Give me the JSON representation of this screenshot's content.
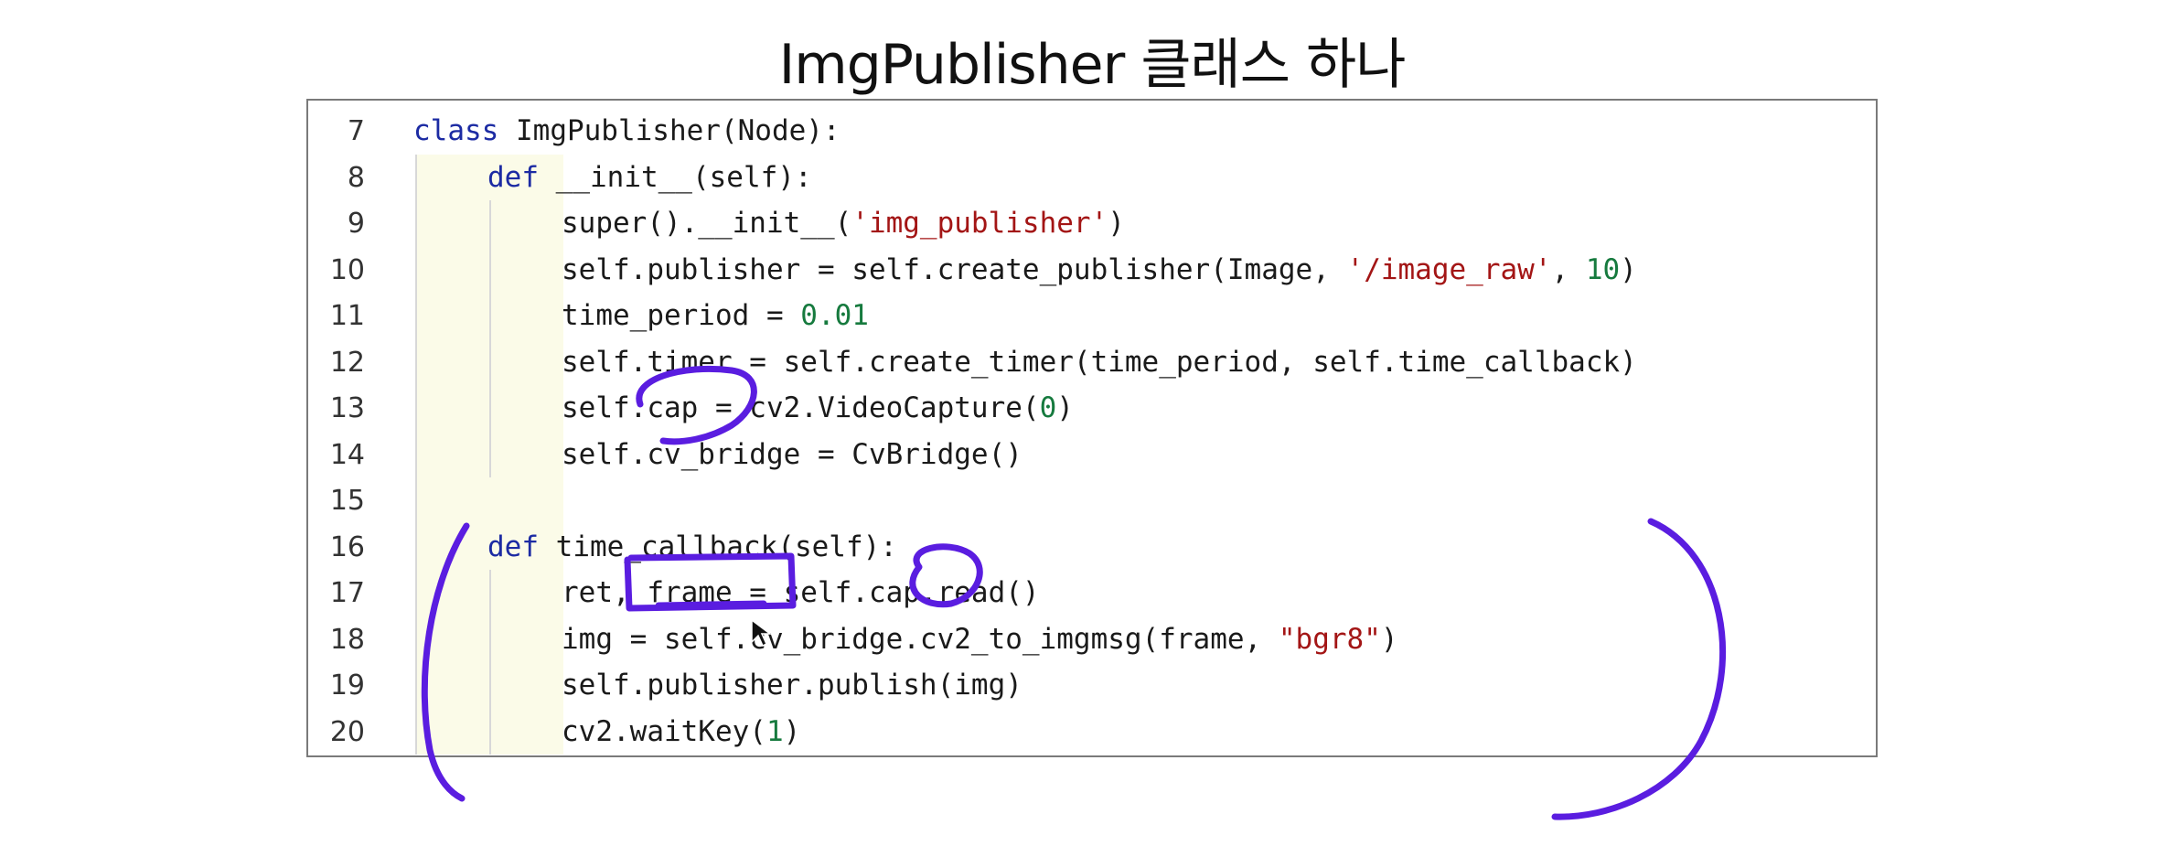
{
  "title": "ImgPublisher 클래스 하나",
  "code": {
    "lines": [
      {
        "no": "7",
        "indent": 0,
        "text": "class ImgPublisher(Node):"
      },
      {
        "no": "8",
        "indent": 1,
        "text": "def __init__(self):"
      },
      {
        "no": "9",
        "indent": 2,
        "text": "super().__init__('img_publisher')"
      },
      {
        "no": "10",
        "indent": 2,
        "text": "self.publisher = self.create_publisher(Image, '/image_raw', 10)"
      },
      {
        "no": "11",
        "indent": 2,
        "text": "time_period = 0.01"
      },
      {
        "no": "12",
        "indent": 2,
        "text": "self.timer = self.create_timer(time_period, self.time_callback)"
      },
      {
        "no": "13",
        "indent": 2,
        "text": "self.cap = cv2.VideoCapture(0)"
      },
      {
        "no": "14",
        "indent": 2,
        "text": "self.cv_bridge = CvBridge()"
      },
      {
        "no": "15",
        "indent": 0,
        "text": ""
      },
      {
        "no": "16",
        "indent": 1,
        "text": "def time_callback(self):"
      },
      {
        "no": "17",
        "indent": 2,
        "text": "ret, frame = self.cap.read()"
      },
      {
        "no": "18",
        "indent": 2,
        "text": "img = self.cv_bridge.cv2_to_imgmsg(frame, \"bgr8\")"
      },
      {
        "no": "19",
        "indent": 2,
        "text": "self.publisher.publish(img)"
      },
      {
        "no": "20",
        "indent": 2,
        "text": "cv2.waitKey(1)"
      }
    ]
  },
  "colors": {
    "keyword": "#1c2ba3",
    "string": "#a31515",
    "number": "#167a3e",
    "annotation": "#5a1de0"
  },
  "annotations": [
    "circle-cap-line13",
    "box-frame-line17",
    "circle-cap-line17",
    "bracket-left",
    "bracket-right"
  ]
}
